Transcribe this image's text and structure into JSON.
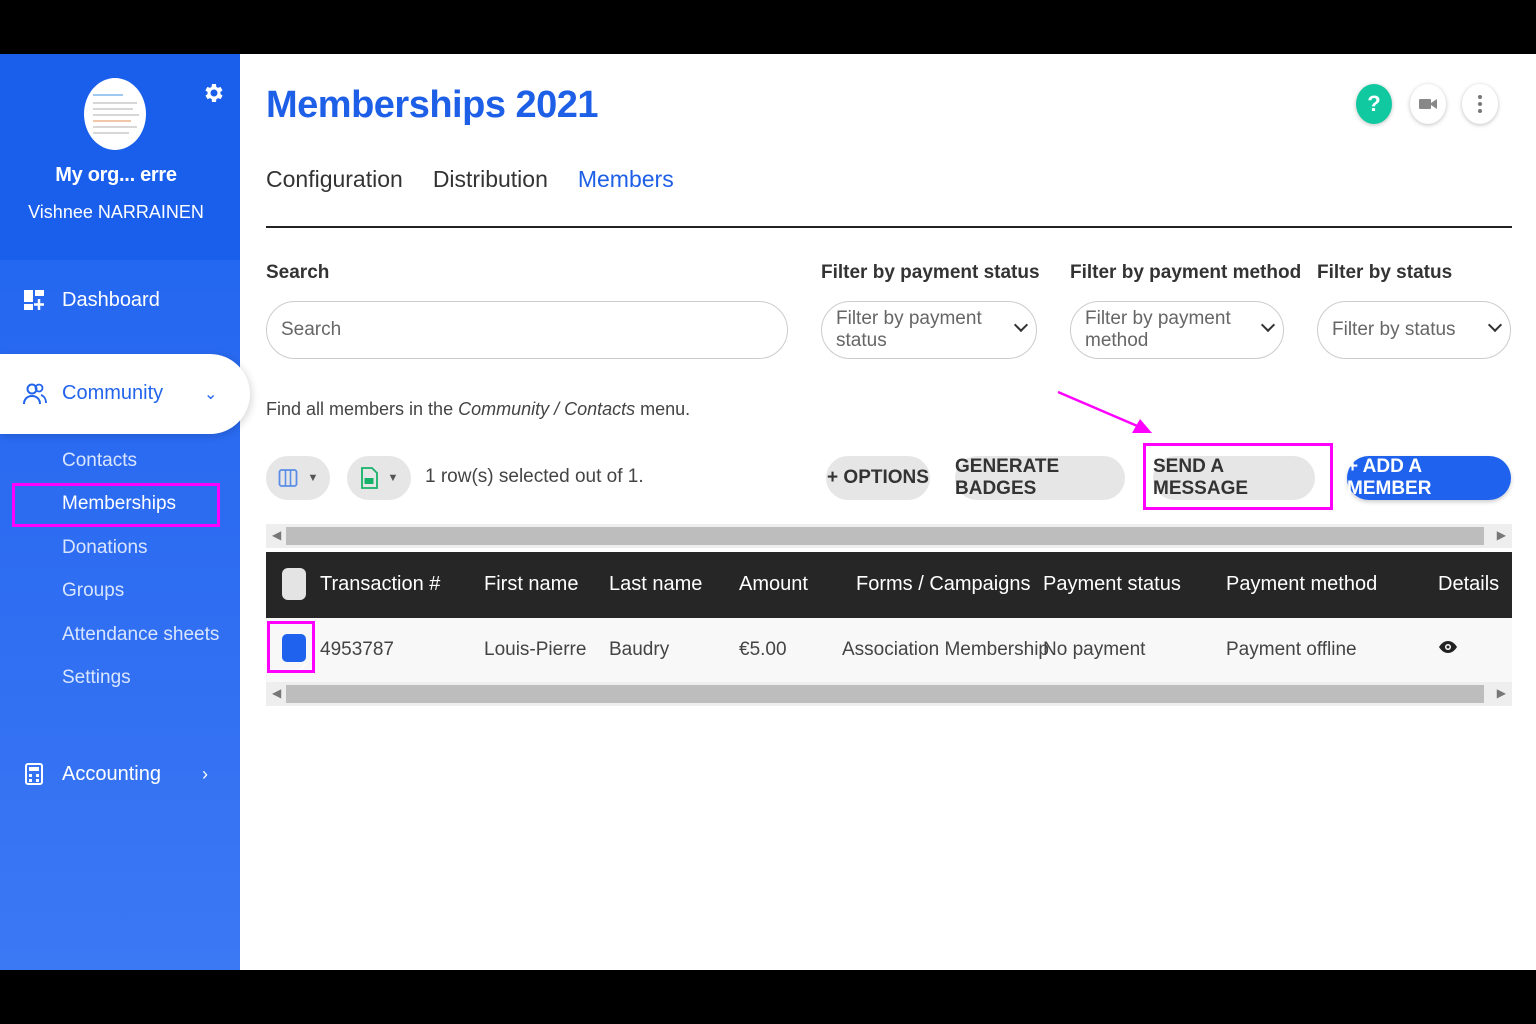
{
  "sidebar": {
    "org_name": "My org... erre",
    "user_name": "Vishnee NARRAINEN",
    "dashboard": "Dashboard",
    "community": "Community",
    "community_sub": [
      "Contacts",
      "Memberships",
      "Donations",
      "Groups",
      "Attendance sheets",
      "Settings"
    ],
    "accounting": "Accounting"
  },
  "header": {
    "title": "Memberships 2021",
    "help": "?"
  },
  "tabs": [
    "Configuration",
    "Distribution",
    "Members"
  ],
  "filters": {
    "search_label": "Search",
    "search_placeholder": "Search",
    "payment_status_label": "Filter by payment status",
    "payment_status_value": "Filter by payment status",
    "payment_method_label": "Filter by payment method",
    "payment_method_value": "Filter by payment method",
    "status_label": "Filter by status",
    "status_value": "Filter by status"
  },
  "hint": {
    "prefix": "Find all members in the ",
    "path": "Community / Contacts",
    "suffix": " menu."
  },
  "toolbar": {
    "selection": "1 row(s) selected out of 1.",
    "options": "+ OPTIONS",
    "badges": "GENERATE BADGES",
    "message": "SEND A MESSAGE",
    "add_member": "+ ADD A MEMBER"
  },
  "table": {
    "columns": [
      "Transaction #",
      "First name",
      "Last name",
      "Amount",
      "Forms / Campaigns",
      "Payment status",
      "Payment method",
      "Details"
    ],
    "rows": [
      {
        "transaction": "4953787",
        "first_name": "Louis-Pierre",
        "last_name": "Baudry",
        "amount": "€5.00",
        "form": "Association Membership",
        "payment_status": "No payment",
        "payment_method": "Payment offline"
      }
    ]
  },
  "colors": {
    "sidebar": "#1e63ee",
    "accent": "#1e5fe8",
    "highlight": "#ff00ff",
    "help": "#10c9a0"
  }
}
